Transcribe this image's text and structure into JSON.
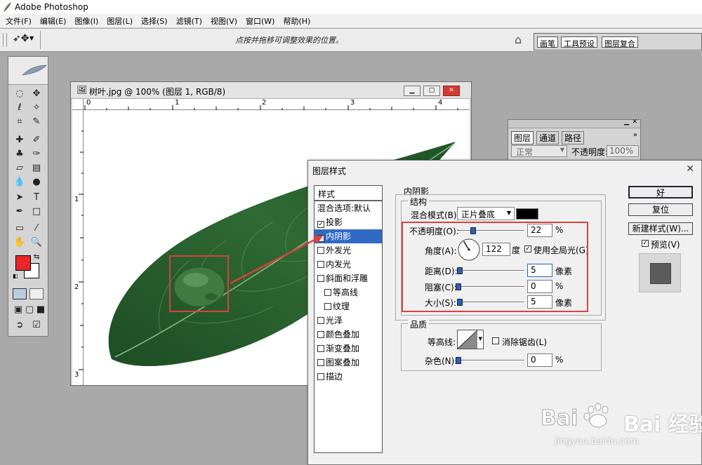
{
  "app": {
    "title": "Adobe Photoshop"
  },
  "menu": [
    "文件(F)",
    "编辑(E)",
    "图像(I)",
    "图层(L)",
    "选择(S)",
    "滤镜(T)",
    "视图(V)",
    "窗口(W)",
    "帮助(H)"
  ],
  "options_bar": {
    "hint": "点按并拖移可调整效果的位置。",
    "palette_tabs": [
      "画笔",
      "工具预设",
      "图层复合"
    ]
  },
  "document": {
    "title": "树叶.jpg @ 100% (图层 1, RGB/8)",
    "ruler_h": [
      "0",
      "1",
      "2",
      "3",
      "4"
    ],
    "ruler_v": [
      "1",
      "2",
      "3"
    ]
  },
  "layers_panel": {
    "tabs": [
      "图层",
      "通道",
      "路径"
    ],
    "blend_mode": "正常",
    "opacity_label": "不透明度:",
    "opacity_value": "100%"
  },
  "dialog": {
    "title": "图层样式",
    "styles_header": "样式",
    "blend_options": "混合选项:默认",
    "styles": [
      {
        "label": "投影",
        "checked": true,
        "indent": false,
        "active": false
      },
      {
        "label": "内阴影",
        "checked": true,
        "indent": false,
        "active": true
      },
      {
        "label": "外发光",
        "checked": false,
        "indent": false,
        "active": false
      },
      {
        "label": "内发光",
        "checked": false,
        "indent": false,
        "active": false
      },
      {
        "label": "斜面和浮雕",
        "checked": false,
        "indent": false,
        "active": false
      },
      {
        "label": "等高线",
        "checked": false,
        "indent": true,
        "active": false
      },
      {
        "label": "纹理",
        "checked": false,
        "indent": true,
        "active": false
      },
      {
        "label": "光泽",
        "checked": false,
        "indent": false,
        "active": false
      },
      {
        "label": "颜色叠加",
        "checked": false,
        "indent": false,
        "active": false
      },
      {
        "label": "渐变叠加",
        "checked": false,
        "indent": false,
        "active": false
      },
      {
        "label": "图案叠加",
        "checked": false,
        "indent": false,
        "active": false
      },
      {
        "label": "描边",
        "checked": false,
        "indent": false,
        "active": false
      }
    ],
    "section_title": "内阴影",
    "structure": {
      "title": "结构",
      "blend_mode_label": "混合模式(B):",
      "blend_mode_value": "正片叠底",
      "shadow_color": "#000000",
      "opacity_label": "不透明度(O):",
      "opacity_value": "22",
      "opacity_unit": "%",
      "angle_label": "角度(A):",
      "angle_value": "122",
      "angle_unit": "度",
      "global_light_label": "使用全局光(G)",
      "distance_label": "距离(D):",
      "distance_value": "5",
      "distance_unit": "像素",
      "choke_label": "阻塞(C):",
      "choke_value": "0",
      "choke_unit": "%",
      "size_label": "大小(S):",
      "size_value": "5",
      "size_unit": "像素"
    },
    "quality": {
      "title": "品质",
      "contour_label": "等高线:",
      "antialias_label": "消除锯齿(L)",
      "noise_label": "杂色(N):",
      "noise_value": "0",
      "noise_unit": "%"
    },
    "buttons": {
      "ok": "好",
      "reset": "复位",
      "new_style": "新建样式(W)...",
      "preview": "预览(V)"
    }
  },
  "watermark": {
    "brand": "Bai 经验",
    "url": "jingyan.baidu.com"
  },
  "colors": {
    "foreground": "#e8262b",
    "background": "#ffffff",
    "highlight": "#d9413d",
    "selection": "#316ac5"
  }
}
